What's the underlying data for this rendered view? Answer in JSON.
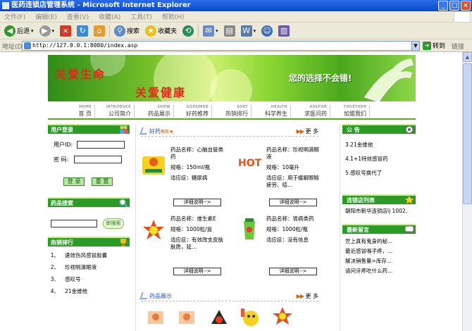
{
  "window": {
    "title": "医药连锁店管理系统 - Microsoft Internet Explorer",
    "buttons": [
      "_",
      "□",
      "×"
    ]
  },
  "menu": [
    "文件(F)",
    "编辑(E)",
    "查看(V)",
    "收藏(A)",
    "工具(T)",
    "帮助(H)"
  ],
  "toolbar": {
    "back": "后退",
    "search": "搜索",
    "favorites": "收藏夹"
  },
  "address": {
    "label": "地址(D)",
    "url": "http://127.0.0.1:8080/index.asp",
    "go": "转到",
    "links": "链接"
  },
  "banner": {
    "line1": "关爱生命",
    "line2": "关爱健康",
    "slogan": "您的选择不会错!"
  },
  "nav": [
    {
      "en": "HOME",
      "cn": "首 页"
    },
    {
      "en": "INTRODUCE",
      "cn": "公司简介"
    },
    {
      "en": "SHOW",
      "cn": "药品展示"
    },
    {
      "en": "GOODMED",
      "cn": "好药推荐"
    },
    {
      "en": "SORT",
      "cn": "热销排行"
    },
    {
      "en": "HEALTH",
      "cn": "科学养生"
    },
    {
      "en": "ASKFOR",
      "cn": "求医问药"
    },
    {
      "en": "TOGETHER",
      "cn": "加盟我们"
    }
  ],
  "login": {
    "title": "用户登录",
    "user_label": "用户ID:",
    "pwd_label": "密  码:",
    "login_btn": "登 录",
    "reset_btn": "重 置"
  },
  "search": {
    "title": "药品搜索",
    "btn": "即搜索"
  },
  "hot": {
    "title": "热销排行",
    "items": [
      {
        "n": "1、",
        "name": "速效伤风感冒胶囊"
      },
      {
        "n": "2、",
        "name": "珍视明滴眼液"
      },
      {
        "n": "3、",
        "name": "感叹号"
      },
      {
        "n": "4、",
        "name": "21金维他"
      }
    ]
  },
  "recommend": {
    "title": "好药",
    "title_suffix": "推荐",
    "more": "更 多",
    "detail_btn": "详细说明-->",
    "products": [
      {
        "name": "药品名称：心脑血管类药",
        "spec": "规格：150ml/瓶",
        "use": "适应症：糖尿病"
      },
      {
        "name": "药品名称：珍视明滴眼液",
        "spec": "规格：10毫升",
        "use": "适应症：用于缓解眼睛疲劳、结..."
      },
      {
        "name": "药品名称：维生素E",
        "spec": "规格：1000粒/盒",
        "use": "适应症：有效改支皮肤肤质，延..."
      },
      {
        "name": "药品名称：胃病类药",
        "spec": "规格：1000粒/瓶",
        "use": "适应症：没有信息"
      }
    ]
  },
  "show": {
    "title": "药品展示",
    "more": "更 多"
  },
  "notice": {
    "title": "公 告",
    "items": [
      "3.21金维他",
      "4.1+1特效感冒药",
      "5.感叹号换代了"
    ]
  },
  "stores": {
    "title": "连锁店列表",
    "items": [
      "朝阳市新华连锁店lj 1002."
    ]
  },
  "messages": {
    "title": "最新留言",
    "items": [
      "世上真有鬼身的秘...",
      "最近感冒鳴子疼，...",
      "解决销售量>库存...",
      "请问牙疼吃什么药..."
    ]
  }
}
